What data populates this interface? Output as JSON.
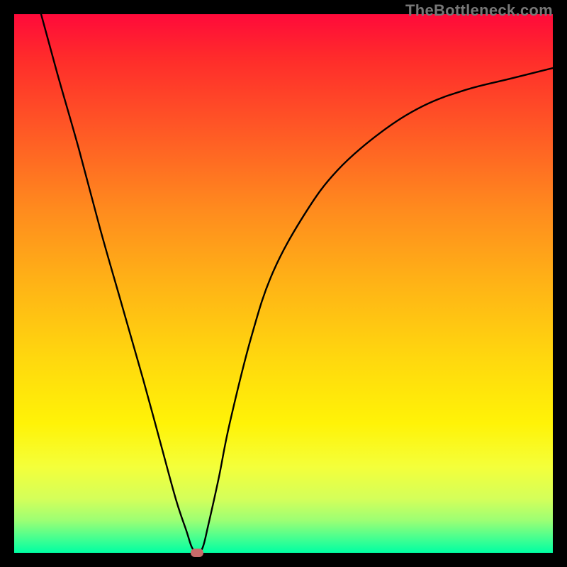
{
  "watermark": "TheBottleneck.com",
  "colors": {
    "frame": "#000000",
    "curve": "#000000",
    "marker": "#c96a6a",
    "gradient_top": "#ff0a3a",
    "gradient_bottom": "#00ffa3"
  },
  "chart_data": {
    "type": "line",
    "title": "",
    "xlabel": "",
    "ylabel": "",
    "xlim": [
      0,
      100
    ],
    "ylim": [
      0,
      100
    ],
    "x": [
      5,
      8,
      12,
      16,
      20,
      24,
      27,
      30,
      32,
      33,
      34,
      35,
      36,
      38,
      40,
      44,
      48,
      54,
      60,
      68,
      76,
      84,
      92,
      100
    ],
    "values": [
      100,
      89,
      75,
      60,
      46,
      32,
      21,
      10,
      4,
      1,
      0,
      1,
      5,
      14,
      24,
      40,
      52,
      63,
      71,
      78,
      83,
      86,
      88,
      90
    ],
    "annotations": [
      {
        "label": "minimum-marker",
        "x": 34,
        "y": 0
      }
    ],
    "grid": false,
    "legend": false
  }
}
